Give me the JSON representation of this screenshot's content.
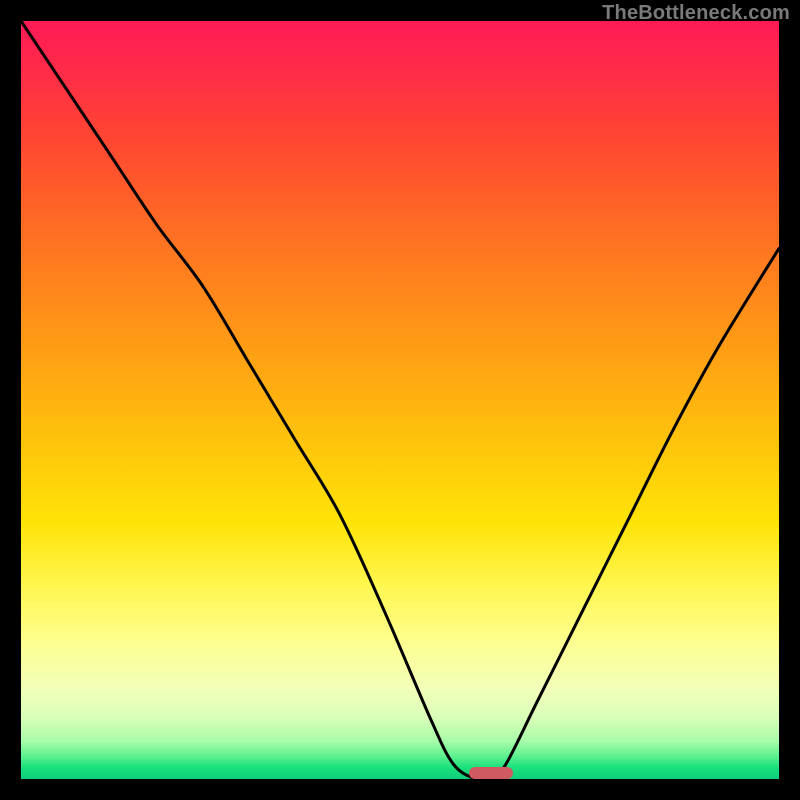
{
  "watermark": "TheBottleneck.com",
  "colors": {
    "frame": "#000000",
    "curve": "#000000",
    "marker": "#cf5a61"
  },
  "chart_data": {
    "type": "line",
    "title": "",
    "xlabel": "",
    "ylabel": "",
    "xlim": [
      0,
      100
    ],
    "ylim": [
      0,
      100
    ],
    "grid": false,
    "legend": false,
    "series": [
      {
        "name": "bottleneck-curve",
        "x": [
          0,
          6,
          12,
          18,
          24,
          30,
          36,
          42,
          48,
          54,
          57,
          60,
          62,
          64,
          68,
          74,
          80,
          86,
          92,
          100
        ],
        "values": [
          100,
          91,
          82,
          73,
          65,
          55,
          45,
          35,
          22,
          8,
          2,
          0,
          0,
          2,
          10,
          22,
          34,
          46,
          57,
          70
        ]
      }
    ],
    "marker": {
      "x_center": 62,
      "y": 0,
      "color": "#cf5a61"
    },
    "gradient_stops": [
      {
        "pct": 0,
        "color": "#ff1a56"
      },
      {
        "pct": 15,
        "color": "#ff4433"
      },
      {
        "pct": 42,
        "color": "#ff9a16"
      },
      {
        "pct": 66,
        "color": "#ffe307"
      },
      {
        "pct": 88,
        "color": "#f3ffb8"
      },
      {
        "pct": 100,
        "color": "#0fcf7a"
      }
    ]
  }
}
